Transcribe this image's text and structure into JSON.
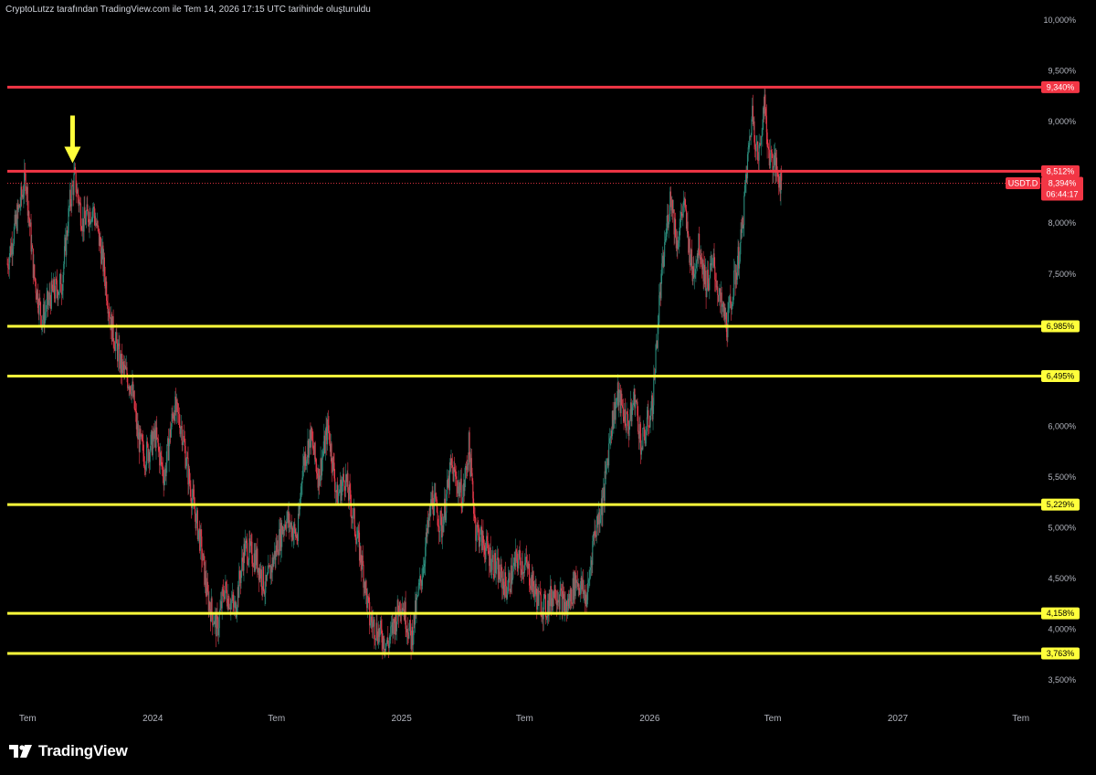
{
  "header": {
    "caption": "CryptoLutzz tarafından TradingView.com ile Tem 14, 2026 17:15 UTC tarihinde oluşturuldu"
  },
  "branding": {
    "logo_text": "TradingView"
  },
  "colors": {
    "background": "#000000",
    "resistance": "#f23645",
    "support": "#ffff3b",
    "candle_up": "#2a8a7a",
    "candle_down": "#e8394a",
    "arrow": "#ffff3b"
  },
  "chart_data": {
    "type": "candlestick",
    "symbol": "USDT.D",
    "y_scale": "linear",
    "y_range": [
      3.25,
      10.0
    ],
    "x_range": [
      "2023-06-01",
      "2027-07-31"
    ],
    "yticks": [
      "10,000%",
      "9,500%",
      "9,000%",
      "8,000%",
      "7,500%",
      "6,000%",
      "5,500%",
      "5,000%",
      "4,500%",
      "4,000%",
      "3,500%"
    ],
    "ytick_values": [
      10.0,
      9.5,
      9.0,
      8.0,
      7.5,
      6.0,
      5.5,
      5.0,
      4.5,
      4.0,
      3.5
    ],
    "xticks": [
      {
        "label": "Tem",
        "date": "2023-07-01"
      },
      {
        "label": "2024",
        "date": "2024-01-01"
      },
      {
        "label": "Tem",
        "date": "2024-07-01"
      },
      {
        "label": "2025",
        "date": "2025-01-01"
      },
      {
        "label": "Tem",
        "date": "2025-07-01"
      },
      {
        "label": "2026",
        "date": "2026-01-01"
      },
      {
        "label": "Tem",
        "date": "2026-07-01"
      },
      {
        "label": "2027",
        "date": "2027-01-01"
      },
      {
        "label": "Tem",
        "date": "2027-07-01"
      }
    ],
    "levels": [
      {
        "value": 9.34,
        "label": "9,340%",
        "kind": "resistance"
      },
      {
        "value": 8.512,
        "label": "8,512%",
        "kind": "resistance"
      },
      {
        "value": 6.985,
        "label": "6,985%",
        "kind": "support"
      },
      {
        "value": 6.495,
        "label": "6,495%",
        "kind": "support"
      },
      {
        "value": 5.229,
        "label": "5,229%",
        "kind": "support"
      },
      {
        "value": 4.158,
        "label": "4,158%",
        "kind": "support"
      },
      {
        "value": 3.763,
        "label": "3,763%",
        "kind": "support"
      }
    ],
    "current": {
      "value": 8.394,
      "label": "8,394%",
      "symbol_label": "USDT.D",
      "countdown": "06:44:17"
    },
    "annotations": [
      {
        "type": "arrow-down",
        "date": "2023-09-05",
        "value": 8.52
      }
    ],
    "price_path": [
      [
        "2023-06-01",
        7.6
      ],
      [
        "2023-06-20",
        8.2
      ],
      [
        "2023-06-28",
        8.45
      ],
      [
        "2023-07-10",
        7.5
      ],
      [
        "2023-07-22",
        7.05
      ],
      [
        "2023-08-05",
        7.3
      ],
      [
        "2023-08-20",
        7.4
      ],
      [
        "2023-09-01",
        8.2
      ],
      [
        "2023-09-08",
        8.45
      ],
      [
        "2023-09-20",
        8.0
      ],
      [
        "2023-10-05",
        8.15
      ],
      [
        "2023-10-18",
        7.7
      ],
      [
        "2023-11-01",
        7.0
      ],
      [
        "2023-11-15",
        6.6
      ],
      [
        "2023-12-01",
        6.4
      ],
      [
        "2023-12-10",
        5.9
      ],
      [
        "2023-12-20",
        5.7
      ],
      [
        "2024-01-05",
        5.9
      ],
      [
        "2024-01-18",
        5.5
      ],
      [
        "2024-02-01",
        6.2
      ],
      [
        "2024-02-12",
        6.0
      ],
      [
        "2024-02-25",
        5.4
      ],
      [
        "2024-03-10",
        4.9
      ],
      [
        "2024-03-22",
        4.3
      ],
      [
        "2024-04-05",
        4.0
      ],
      [
        "2024-04-15",
        4.4
      ],
      [
        "2024-05-01",
        4.2
      ],
      [
        "2024-05-15",
        4.8
      ],
      [
        "2024-06-01",
        4.7
      ],
      [
        "2024-06-15",
        4.4
      ],
      [
        "2024-07-01",
        4.8
      ],
      [
        "2024-07-15",
        5.1
      ],
      [
        "2024-08-01",
        4.9
      ],
      [
        "2024-08-08",
        5.6
      ],
      [
        "2024-08-20",
        5.9
      ],
      [
        "2024-09-01",
        5.5
      ],
      [
        "2024-09-15",
        6.0
      ],
      [
        "2024-09-28",
        5.3
      ],
      [
        "2024-10-10",
        5.5
      ],
      [
        "2024-10-25",
        5.0
      ],
      [
        "2024-11-05",
        4.6
      ],
      [
        "2024-11-15",
        4.1
      ],
      [
        "2024-12-01",
        3.95
      ],
      [
        "2024-12-12",
        3.85
      ],
      [
        "2025-01-01",
        4.3
      ],
      [
        "2025-01-15",
        3.9
      ],
      [
        "2025-02-01",
        4.6
      ],
      [
        "2025-02-15",
        5.3
      ],
      [
        "2025-03-01",
        5.0
      ],
      [
        "2025-03-15",
        5.6
      ],
      [
        "2025-04-01",
        5.3
      ],
      [
        "2025-04-10",
        5.8
      ],
      [
        "2025-04-20",
        5.0
      ],
      [
        "2025-05-05",
        4.8
      ],
      [
        "2025-05-20",
        4.6
      ],
      [
        "2025-06-05",
        4.4
      ],
      [
        "2025-06-20",
        4.7
      ],
      [
        "2025-07-05",
        4.6
      ],
      [
        "2025-07-20",
        4.3
      ],
      [
        "2025-08-01",
        4.2
      ],
      [
        "2025-08-15",
        4.4
      ],
      [
        "2025-09-01",
        4.2
      ],
      [
        "2025-09-15",
        4.5
      ],
      [
        "2025-10-01",
        4.3
      ],
      [
        "2025-10-10",
        4.9
      ],
      [
        "2025-10-25",
        5.3
      ],
      [
        "2025-11-05",
        6.0
      ],
      [
        "2025-11-15",
        6.3
      ],
      [
        "2025-12-01",
        6.0
      ],
      [
        "2025-12-10",
        6.3
      ],
      [
        "2025-12-20",
        5.8
      ],
      [
        "2026-01-05",
        6.2
      ],
      [
        "2026-01-15",
        7.2
      ],
      [
        "2026-01-25",
        7.9
      ],
      [
        "2026-02-01",
        8.3
      ],
      [
        "2026-02-10",
        7.8
      ],
      [
        "2026-02-20",
        8.2
      ],
      [
        "2026-03-05",
        7.5
      ],
      [
        "2026-03-15",
        7.8
      ],
      [
        "2026-03-25",
        7.4
      ],
      [
        "2026-04-05",
        7.6
      ],
      [
        "2026-04-15",
        7.2
      ],
      [
        "2026-04-25",
        7.0
      ],
      [
        "2026-05-05",
        7.4
      ],
      [
        "2026-05-15",
        7.8
      ],
      [
        "2026-05-25",
        8.6
      ],
      [
        "2026-06-01",
        9.1
      ],
      [
        "2026-06-10",
        8.6
      ],
      [
        "2026-06-18",
        9.2
      ],
      [
        "2026-06-25",
        8.7
      ],
      [
        "2026-07-05",
        8.55
      ],
      [
        "2026-07-14",
        8.394
      ]
    ]
  }
}
